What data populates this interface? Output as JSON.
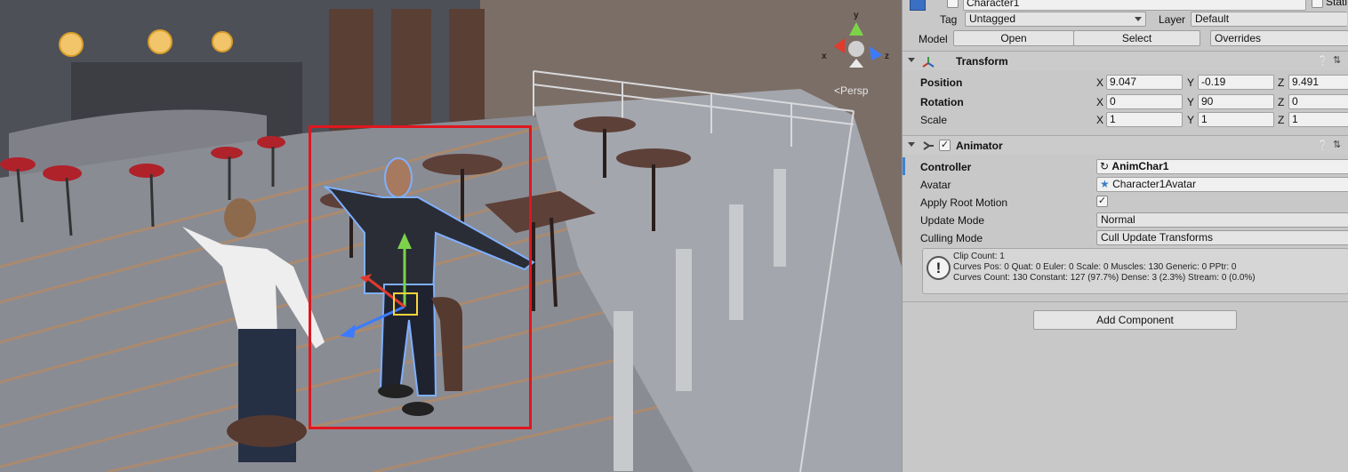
{
  "scene": {
    "camera_mode": "Persp",
    "gizmo_axes": {
      "x": "x",
      "y": "y",
      "z": "z"
    }
  },
  "header": {
    "object_name": "Character1",
    "static_label": "Stati",
    "tag_label": "Tag",
    "tag_value": "Untagged",
    "layer_label": "Layer",
    "layer_value": "Default",
    "model_label": "Model",
    "open_label": "Open",
    "select_label": "Select",
    "overrides_label": "Overrides"
  },
  "transform": {
    "title": "Transform",
    "position_label": "Position",
    "rotation_label": "Rotation",
    "scale_label": "Scale",
    "position": {
      "x": "9.047",
      "y": "-0.19",
      "z": "9.491"
    },
    "rotation": {
      "x": "0",
      "y": "90",
      "z": "0"
    },
    "scale": {
      "x": "1",
      "y": "1",
      "z": "1"
    }
  },
  "animator": {
    "title": "Animator",
    "enabled": true,
    "controller_label": "Controller",
    "controller_value": "AnimChar1",
    "avatar_label": "Avatar",
    "avatar_value": "Character1Avatar",
    "apply_root_motion_label": "Apply Root Motion",
    "apply_root_motion": true,
    "update_mode_label": "Update Mode",
    "update_mode_value": "Normal",
    "culling_mode_label": "Culling Mode",
    "culling_mode_value": "Cull Update Transforms",
    "info": {
      "line1": "Clip Count: 1",
      "line2": "Curves Pos: 0 Quat: 0 Euler: 0 Scale: 0 Muscles: 130 Generic: 0 PPtr: 0",
      "line3": "Curves Count: 130 Constant: 127 (97.7%) Dense: 3 (2.3%) Stream: 0 (0.0%)"
    }
  },
  "add_component_label": "Add Component",
  "colors": {
    "selection_box": "#e0161f",
    "inspector_bg": "#c8c8c8",
    "scene_floor": "#8a8c94"
  }
}
